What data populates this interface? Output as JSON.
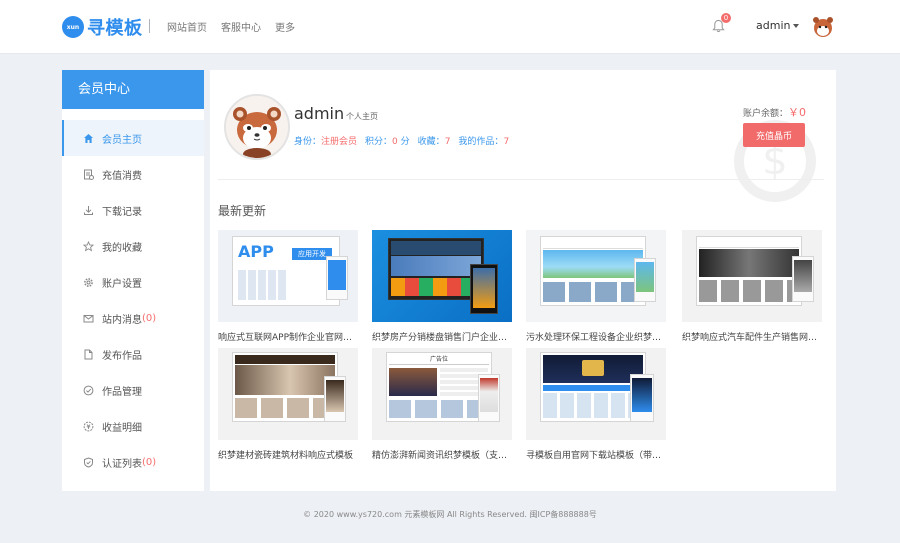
{
  "header": {
    "logo_badge": "xun",
    "logo_text": "寻模板",
    "nav": [
      "网站首页",
      "客服中心",
      "更多"
    ],
    "notification_count": "0",
    "username": "admin"
  },
  "sidebar": {
    "title": "会员中心",
    "items": [
      {
        "label": "会员主页",
        "icon": "home-icon",
        "active": true
      },
      {
        "label": "充值消费",
        "icon": "receipt-icon"
      },
      {
        "label": "下载记录",
        "icon": "download-icon"
      },
      {
        "label": "我的收藏",
        "icon": "star-icon"
      },
      {
        "label": "账户设置",
        "icon": "gear-icon"
      },
      {
        "label": "站内消息",
        "icon": "mail-icon",
        "count": "(0)"
      },
      {
        "label": "发布作品",
        "icon": "document-icon"
      },
      {
        "label": "作品管理",
        "icon": "check-circle-icon"
      },
      {
        "label": "收益明细",
        "icon": "money-icon"
      },
      {
        "label": "认证列表",
        "icon": "shield-icon",
        "count": "(0)"
      }
    ]
  },
  "profile": {
    "name": "admin",
    "homepage_link": "个人主页",
    "identity_label": "身份：",
    "identity_value": "注册会员",
    "points_label": "积分：",
    "points_value": "0",
    "points_unit": "分",
    "favorites_label": "收藏：",
    "favorites_value": "7",
    "works_label": "我的作品：",
    "works_value": "7",
    "balance_label": "账户余额：",
    "balance_value": "￥0",
    "recharge_button": "充值晶币"
  },
  "latest": {
    "title": "最新更新",
    "items": [
      {
        "title": "响应式互联网APP制作企业官网织梦模板",
        "thumb_text": "APP",
        "thumb_sub": "应用开发"
      },
      {
        "title": "织梦房产分销楼盘销售门户企业模板(带...",
        "thumb_text": "",
        "thumb_sub": ""
      },
      {
        "title": "污水处理环保工程设备企业织梦模板(带...",
        "thumb_text": "",
        "thumb_sub": ""
      },
      {
        "title": "织梦响应式汽车配件生产销售网站模板",
        "thumb_text": "",
        "thumb_sub": ""
      },
      {
        "title": "织梦建材瓷砖建筑材料响应式模板",
        "thumb_text": "",
        "thumb_sub": ""
      },
      {
        "title": "精仿澎湃新闻资讯织梦模板（支持移动...",
        "thumb_text": "广告位",
        "thumb_sub": ""
      },
      {
        "title": "寻模板自用官网下载站模板（带会员中...",
        "thumb_text": "",
        "thumb_sub": ""
      }
    ]
  },
  "footer": {
    "text": "© 2020 www.ys720.com 元素模板网 All Rights Reserved. 闽ICP备888888号"
  },
  "colors": {
    "accent": "#3a97ec",
    "danger": "#f26b6b",
    "background": "#edf0f5"
  }
}
